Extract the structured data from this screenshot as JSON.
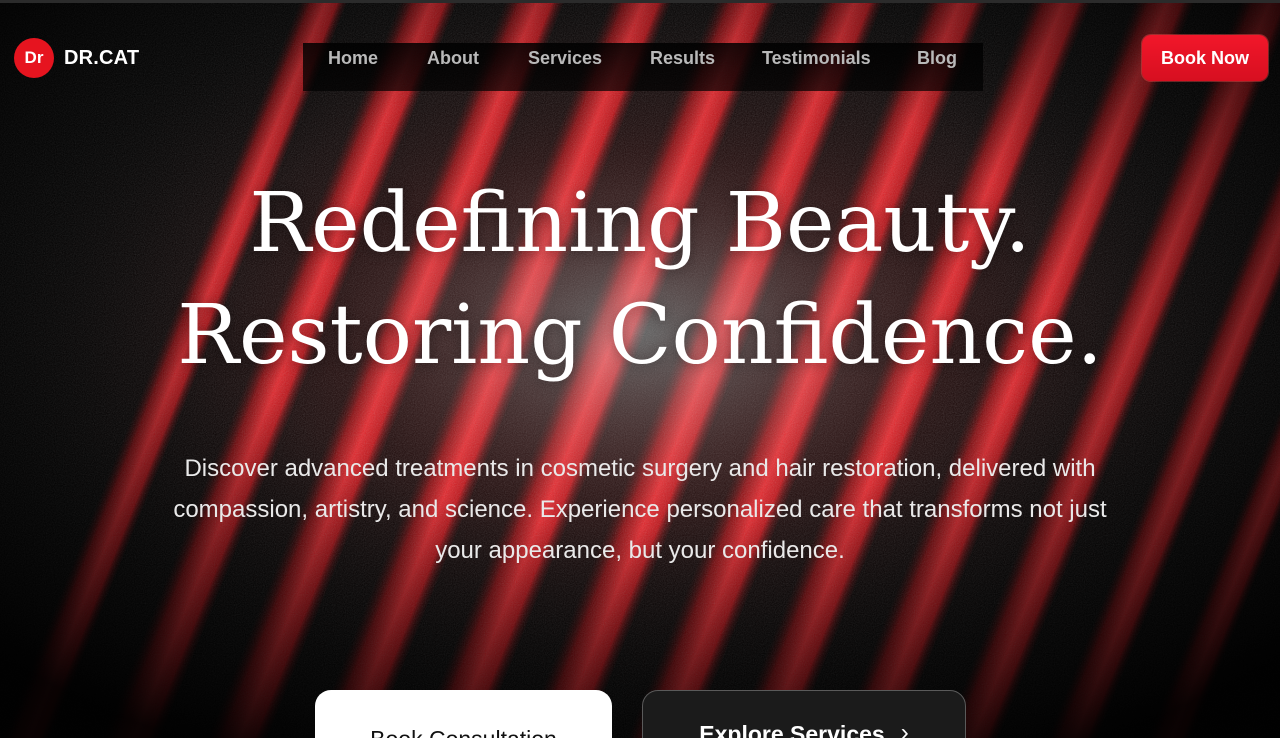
{
  "colors": {
    "accent": "#e6141f",
    "background": "#000000",
    "stripe": "#c21218"
  },
  "brand": {
    "badge": "Dr",
    "name": "DR.CAT"
  },
  "nav": {
    "items": [
      {
        "label": "Home"
      },
      {
        "label": "About"
      },
      {
        "label": "Services"
      },
      {
        "label": "Results"
      },
      {
        "label": "Testimonials"
      },
      {
        "label": "Blog"
      }
    ]
  },
  "header": {
    "cta_label": "Book Now"
  },
  "hero": {
    "title_line_1": "Redefining Beauty.",
    "title_line_2": "Restoring Confidence.",
    "subtitle": "Discover advanced treatments in cosmetic surgery and hair restoration, delivered with compassion, artistry, and science. Experience personalized care that transforms not just your appearance, but your confidence.",
    "primary_cta": "Book Consultation",
    "secondary_cta": "Explore Services",
    "secondary_cta_icon": "chevron-right-icon"
  }
}
